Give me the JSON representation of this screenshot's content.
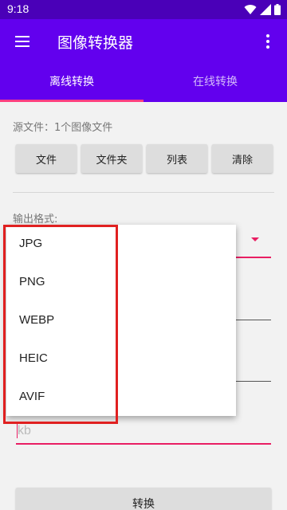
{
  "status_bar": {
    "time": "9:18"
  },
  "app_bar": {
    "title": "图像转换器",
    "menu_icon": "hamburger-menu-icon",
    "more_icon": "more-vert-icon"
  },
  "tabs": [
    {
      "label": "离线转换",
      "selected": true
    },
    {
      "label": "在线转换",
      "selected": false
    }
  ],
  "source": {
    "label": "源文件：1个图像文件"
  },
  "buttons": [
    "文件",
    "文件夹",
    "列表",
    "清除"
  ],
  "output_format": {
    "label": "输出格式:"
  },
  "format_options": [
    "JPG",
    "PNG",
    "WEBP",
    "HEIC",
    "AVIF"
  ],
  "size_input": {
    "placeholder": "kb"
  },
  "convert_label": "转换",
  "colors": {
    "app_bar": "#6200ee",
    "status_bar": "#4a00b8",
    "accent": "#e91e63",
    "highlight": "#e02020"
  }
}
